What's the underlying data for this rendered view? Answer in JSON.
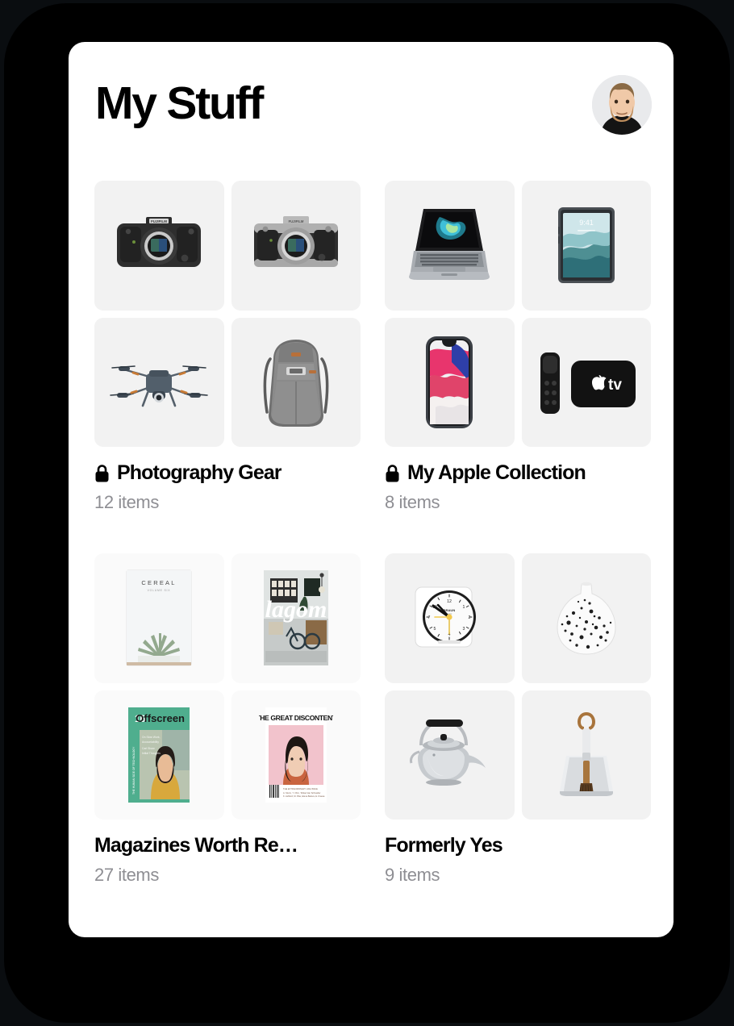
{
  "header": {
    "title": "My Stuff",
    "avatar_alt": "user-avatar"
  },
  "collections": [
    {
      "title": "Photography Gear",
      "count": "12 items",
      "locked": true,
      "tile_style": "gray",
      "items": [
        "fujifilm-black-camera",
        "fujifilm-silver-camera",
        "dji-mavic-drone",
        "peak-design-backpack"
      ]
    },
    {
      "title": "My Apple Collection",
      "count": "8 items",
      "locked": true,
      "tile_style": "gray",
      "items": [
        "macbook-pro",
        "ipad-pro",
        "iphone-x",
        "apple-tv-and-remote"
      ]
    },
    {
      "title": "Magazines Worth Re…",
      "count": "27 items",
      "locked": false,
      "tile_style": "light",
      "items": [
        "cereal-magazine",
        "lagom-magazine",
        "offscreen-magazine-16",
        "the-great-discontent-magazine"
      ]
    },
    {
      "title": "Formerly Yes",
      "count": "9 items",
      "locked": false,
      "tile_style": "gray",
      "items": [
        "braun-alarm-clock",
        "speckled-ceramic-vase",
        "stainless-steel-kettle",
        "dustpan-and-brush"
      ]
    }
  ],
  "colors": {
    "frame": "#000000",
    "card": "#ffffff",
    "tile_gray": "#f2f2f2",
    "tile_light": "#fafafa",
    "title": "#000000",
    "count": "#8e8e93"
  },
  "magazine_covers": {
    "cereal": "CEREAL",
    "lagom": "lagom",
    "offscreen_number": "16",
    "offscreen_name": "Offscreen",
    "tgd": "THE GREAT DISCONTENT"
  }
}
